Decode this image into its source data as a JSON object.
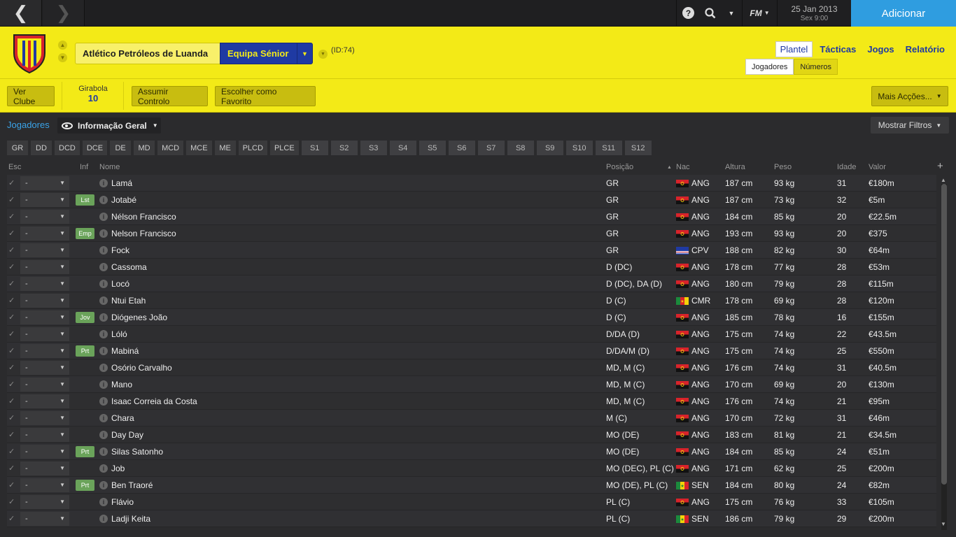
{
  "topbar": {
    "date": "25 Jan 2013",
    "day_time": "Sex 9:00",
    "add_label": "Adicionar",
    "fm_label": "FM",
    "help_label": "?"
  },
  "club": {
    "name": "Atlético Petróleos de Luanda",
    "team": "Equipa Sénior",
    "id": "(ID:74)",
    "colors": {
      "primary": "#f3ea17",
      "secondary": "#1f3aa3",
      "crest_red": "#d8232a"
    }
  },
  "main_tabs": [
    {
      "label": "Plantel"
    },
    {
      "label": "Tácticas"
    },
    {
      "label": "Jogos"
    },
    {
      "label": "Relatório"
    }
  ],
  "sub_tabs": [
    {
      "label": "Jogadores"
    },
    {
      "label": "Números"
    }
  ],
  "actions": {
    "view_club": "Ver Clube",
    "league_name": "Girabola",
    "league_position": "10",
    "take_control": "Assumir Controlo",
    "favourite": "Escolher como Favorito",
    "more_actions": "Mais Acções..."
  },
  "content": {
    "breadcrumb": "Jogadores",
    "view": "Informação Geral",
    "filters_label": "Mostrar Filtros",
    "position_filters": [
      "GR",
      "DD",
      "DCD",
      "DCE",
      "DE",
      "MD",
      "MCD",
      "MCE",
      "ME",
      "PLCD",
      "PLCE"
    ],
    "slot_filters": [
      "S1",
      "S2",
      "S3",
      "S4",
      "S5",
      "S6",
      "S7",
      "S8",
      "S9",
      "S10",
      "S11",
      "S12"
    ]
  },
  "columns": {
    "esc": "Esc",
    "inf": "Inf",
    "name": "Nome",
    "position": "Posição",
    "nat": "Nac",
    "height": "Altura",
    "weight": "Peso",
    "age": "Idade",
    "value": "Valor",
    "add": "+"
  },
  "players": [
    {
      "sel": "-",
      "inf": "",
      "name": "Lamá",
      "pos": "GR",
      "nat": "ANG",
      "height": "187 cm",
      "weight": "93 kg",
      "age": "31",
      "value": "€180m"
    },
    {
      "sel": "-",
      "inf": "Lst",
      "name": "Jotabé",
      "pos": "GR",
      "nat": "ANG",
      "height": "187 cm",
      "weight": "73 kg",
      "age": "32",
      "value": "€5m"
    },
    {
      "sel": "-",
      "inf": "",
      "name": "Nélson Francisco",
      "pos": "GR",
      "nat": "ANG",
      "height": "184 cm",
      "weight": "85 kg",
      "age": "20",
      "value": "€22.5m"
    },
    {
      "sel": "-",
      "inf": "Emp",
      "name": "Nelson Francisco",
      "pos": "GR",
      "nat": "ANG",
      "height": "193 cm",
      "weight": "93 kg",
      "age": "20",
      "value": "€375"
    },
    {
      "sel": "-",
      "inf": "",
      "name": "Fock",
      "pos": "GR",
      "nat": "CPV",
      "height": "188 cm",
      "weight": "82 kg",
      "age": "30",
      "value": "€64m"
    },
    {
      "sel": "-",
      "inf": "",
      "name": "Cassoma",
      "pos": "D (DC)",
      "nat": "ANG",
      "height": "178 cm",
      "weight": "77 kg",
      "age": "28",
      "value": "€53m"
    },
    {
      "sel": "-",
      "inf": "",
      "name": "Locó",
      "pos": "D (DC), DA (D)",
      "nat": "ANG",
      "height": "180 cm",
      "weight": "79 kg",
      "age": "28",
      "value": "€115m"
    },
    {
      "sel": "-",
      "inf": "",
      "name": "Ntui Etah",
      "pos": "D (C)",
      "nat": "CMR",
      "height": "178 cm",
      "weight": "69 kg",
      "age": "28",
      "value": "€120m"
    },
    {
      "sel": "-",
      "inf": "Jov",
      "name": "Diógenes João",
      "pos": "D (C)",
      "nat": "ANG",
      "height": "185 cm",
      "weight": "78 kg",
      "age": "16",
      "value": "€155m"
    },
    {
      "sel": "-",
      "inf": "",
      "name": "Lóló",
      "pos": "D/DA (D)",
      "nat": "ANG",
      "height": "175 cm",
      "weight": "74 kg",
      "age": "22",
      "value": "€43.5m"
    },
    {
      "sel": "-",
      "inf": "Prt",
      "name": "Mabiná",
      "pos": "D/DA/M (D)",
      "nat": "ANG",
      "height": "175 cm",
      "weight": "74 kg",
      "age": "25",
      "value": "€550m"
    },
    {
      "sel": "-",
      "inf": "",
      "name": "Osório Carvalho",
      "pos": "MD, M (C)",
      "nat": "ANG",
      "height": "176 cm",
      "weight": "74 kg",
      "age": "31",
      "value": "€40.5m"
    },
    {
      "sel": "-",
      "inf": "",
      "name": "Mano",
      "pos": "MD, M (C)",
      "nat": "ANG",
      "height": "170 cm",
      "weight": "69 kg",
      "age": "20",
      "value": "€130m"
    },
    {
      "sel": "-",
      "inf": "",
      "name": "Isaac Correia da Costa",
      "pos": "MD, M (C)",
      "nat": "ANG",
      "height": "176 cm",
      "weight": "74 kg",
      "age": "21",
      "value": "€95m"
    },
    {
      "sel": "-",
      "inf": "",
      "name": "Chara",
      "pos": "M (C)",
      "nat": "ANG",
      "height": "170 cm",
      "weight": "72 kg",
      "age": "31",
      "value": "€46m"
    },
    {
      "sel": "-",
      "inf": "",
      "name": "Day Day",
      "pos": "MO (DE)",
      "nat": "ANG",
      "height": "183 cm",
      "weight": "81 kg",
      "age": "21",
      "value": "€34.5m"
    },
    {
      "sel": "-",
      "inf": "Prt",
      "name": "Silas Satonho",
      "pos": "MO (DE)",
      "nat": "ANG",
      "height": "184 cm",
      "weight": "85 kg",
      "age": "24",
      "value": "€51m"
    },
    {
      "sel": "-",
      "inf": "",
      "name": "Job",
      "pos": "MO (DEC), PL (C)",
      "nat": "ANG",
      "height": "171 cm",
      "weight": "62 kg",
      "age": "25",
      "value": "€200m"
    },
    {
      "sel": "-",
      "inf": "Prt",
      "name": "Ben Traoré",
      "pos": "MO (DE), PL (C)",
      "nat": "SEN",
      "height": "184 cm",
      "weight": "80 kg",
      "age": "24",
      "value": "€82m"
    },
    {
      "sel": "-",
      "inf": "",
      "name": "Flávio",
      "pos": "PL (C)",
      "nat": "ANG",
      "height": "175 cm",
      "weight": "76 kg",
      "age": "33",
      "value": "€105m"
    },
    {
      "sel": "-",
      "inf": "",
      "name": "Ladji Keita",
      "pos": "PL (C)",
      "nat": "SEN",
      "height": "186 cm",
      "weight": "79 kg",
      "age": "29",
      "value": "€200m"
    }
  ]
}
